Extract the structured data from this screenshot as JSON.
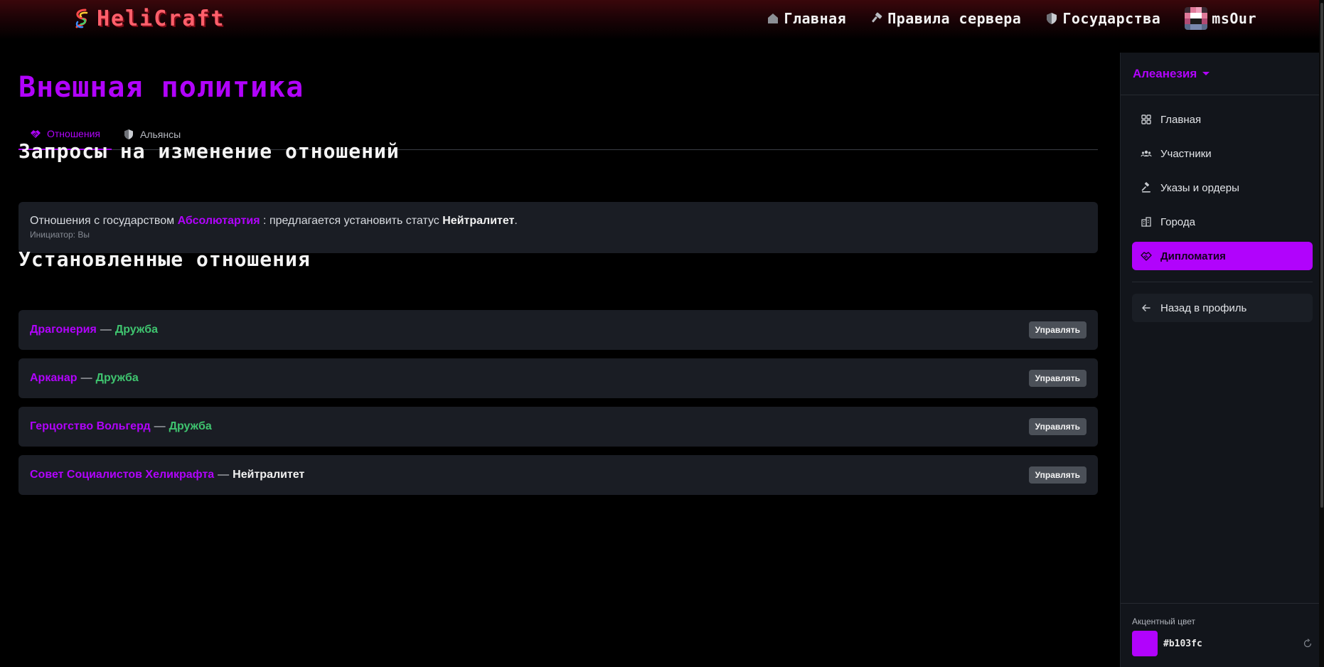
{
  "brand": {
    "name": "HeliCraft",
    "logo_icon": "spiral-logo-icon"
  },
  "topnav": {
    "items": [
      {
        "label": "Главная",
        "icon": "house-icon"
      },
      {
        "label": "Правила сервера",
        "icon": "hammer-icon"
      },
      {
        "label": "Государства",
        "icon": "shield-icon"
      }
    ],
    "user": {
      "name": "msOur",
      "avatar_icon": "pixel-avatar"
    }
  },
  "page": {
    "title": "Внешная политика",
    "tabs": [
      {
        "label": "Отношения",
        "icon": "handshake-icon",
        "active": true
      },
      {
        "label": "Альянсы",
        "icon": "shield-icon",
        "active": false
      }
    ]
  },
  "requests": {
    "title": "Запросы на изменение отношений",
    "items": [
      {
        "prefix": "Отношения с государством",
        "state": "Абсолютартия",
        "middle": ": предлагается установить статус",
        "status": "Нейтралитет",
        "suffix": ".",
        "initiator": "Инициатор: Вы"
      }
    ]
  },
  "relations": {
    "title": "Установленные отношения",
    "dash": "—",
    "manage_label": "Управлять",
    "items": [
      {
        "state": "Драгонерия",
        "status": "Дружба",
        "kind": "friend"
      },
      {
        "state": "Арканар",
        "status": "Дружба",
        "kind": "friend"
      },
      {
        "state": "Герцогство Вольгерд",
        "status": "Дружба",
        "kind": "friend"
      },
      {
        "state": "Совет Социалистов Хеликрафта",
        "status": "Нейтралитет",
        "kind": "neutral"
      }
    ]
  },
  "sidebar": {
    "state_name": "Алеанезия",
    "items": [
      {
        "label": "Главная",
        "icon": "grid-icon"
      },
      {
        "label": "Участники",
        "icon": "users-icon"
      },
      {
        "label": "Указы и ордеры",
        "icon": "gavel-icon"
      },
      {
        "label": "Города",
        "icon": "buildings-icon"
      },
      {
        "label": "Дипломатия",
        "icon": "handshake-icon",
        "active": true
      }
    ],
    "back_label": "Назад в профиль",
    "accent_label": "Акцентный цвет",
    "accent_color": "#b103fc"
  },
  "colors": {
    "accent": "#b103fc",
    "brand": "#ff5f6b",
    "friend": "#3fc46f",
    "card_bg": "#1a1d24"
  }
}
